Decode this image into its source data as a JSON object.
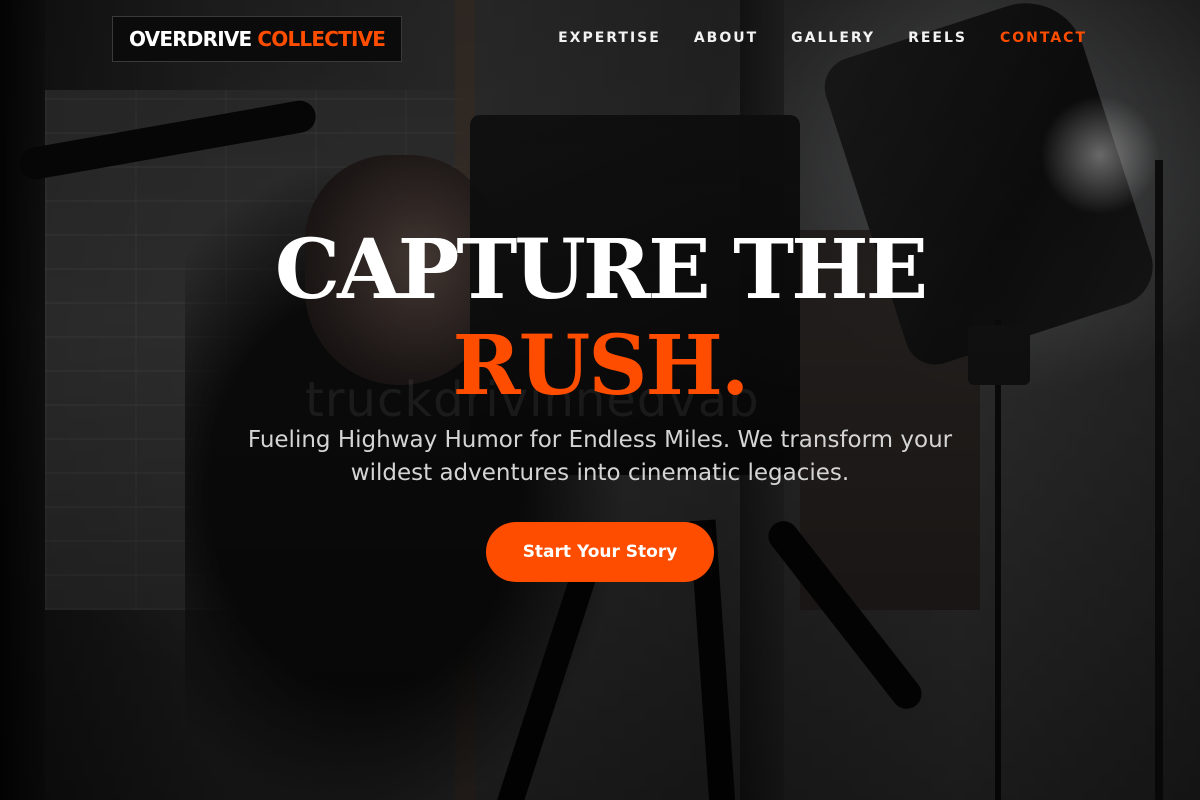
{
  "brand": {
    "name_main": "OVERDRIVE",
    "name_accent": "COLLECTIVE",
    "accent_color": "#ff4d00"
  },
  "nav": {
    "items": [
      {
        "label": "EXPERTISE",
        "active": false
      },
      {
        "label": "ABOUT",
        "active": false
      },
      {
        "label": "GALLERY",
        "active": false
      },
      {
        "label": "REELS",
        "active": false
      },
      {
        "label": "CONTACT",
        "active": true
      }
    ]
  },
  "hero": {
    "title_line1": "CAPTURE THE",
    "title_line2": "RUSH.",
    "ghost_text": "truckdrivinnedvab",
    "subtitle": "Fueling Highway Humor for Endless Miles. We transform your wildest adventures into cinematic legacies.",
    "cta_label": "Start Your Story"
  },
  "background": {
    "description_icon": "filmmaker-with-camera-photo"
  }
}
